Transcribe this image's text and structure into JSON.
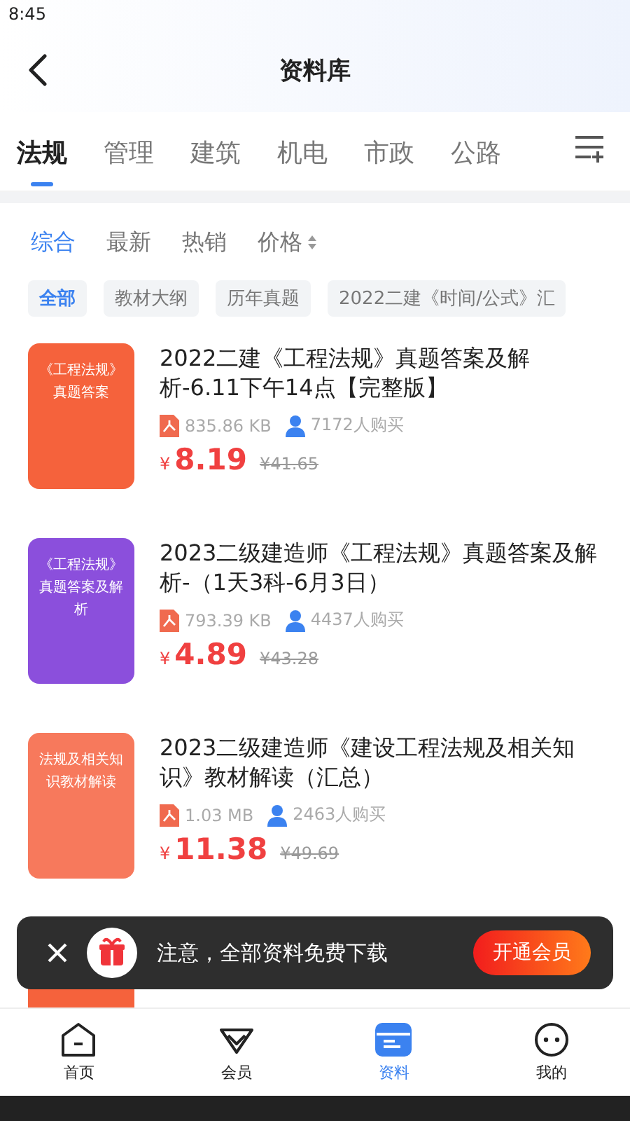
{
  "status_bar": {
    "time": "8:45"
  },
  "header": {
    "title": "资料库"
  },
  "category_tabs": [
    {
      "label": "法规",
      "selected": true
    },
    {
      "label": "管理",
      "selected": false
    },
    {
      "label": "建筑",
      "selected": false
    },
    {
      "label": "机电",
      "selected": false
    },
    {
      "label": "市政",
      "selected": false
    },
    {
      "label": "公路",
      "selected": false
    }
  ],
  "sort_options": [
    {
      "label": "综合",
      "selected": true,
      "kind": "plain"
    },
    {
      "label": "最新",
      "selected": false,
      "kind": "plain"
    },
    {
      "label": "热销",
      "selected": false,
      "kind": "plain"
    },
    {
      "label": "价格",
      "selected": false,
      "kind": "sortable"
    }
  ],
  "filter_chips": [
    {
      "label": "全部",
      "selected": true
    },
    {
      "label": "教材大纲",
      "selected": false
    },
    {
      "label": "历年真题",
      "selected": false
    },
    {
      "label": "2022二建《时间/公式》汇",
      "selected": false
    }
  ],
  "items": [
    {
      "title": "2022二建《工程法规》真题答案及解析-6.11下午14点【完整版】",
      "cover_text": "《工程法规》真题答案",
      "color": "#f5623c",
      "size": "835.86 KB",
      "buyers": "7172人购买",
      "currency": "¥",
      "price": "8.19",
      "old_price": "¥41.65"
    },
    {
      "title": "2023二级建造师《工程法规》真题答案及解析-（1天3科-6月3日）",
      "cover_text": "《工程法规》真题答案及解析",
      "color": "#8b4fdc",
      "size": "793.39 KB",
      "buyers": "4437人购买",
      "currency": "¥",
      "price": "4.89",
      "old_price": "¥43.28"
    },
    {
      "title": "2023二级建造师《建设工程法规及相关知识》教材解读（汇总）",
      "cover_text": "法规及相关知识教材解读",
      "color": "#f7795c",
      "size": "1.03 MB",
      "buyers": "2463人购买",
      "currency": "¥",
      "price": "11.38",
      "old_price": "¥49.69"
    },
    {
      "color": "#f5623c"
    }
  ],
  "toast": {
    "message": "注意，全部资料免费下载",
    "button": "开通会员"
  },
  "bottom_nav": [
    {
      "label": "首页",
      "kind": "home",
      "selected": false
    },
    {
      "label": "会员",
      "kind": "vip",
      "selected": false
    },
    {
      "label": "资料",
      "kind": "docs",
      "selected": true
    },
    {
      "label": "我的",
      "kind": "me",
      "selected": false
    }
  ]
}
